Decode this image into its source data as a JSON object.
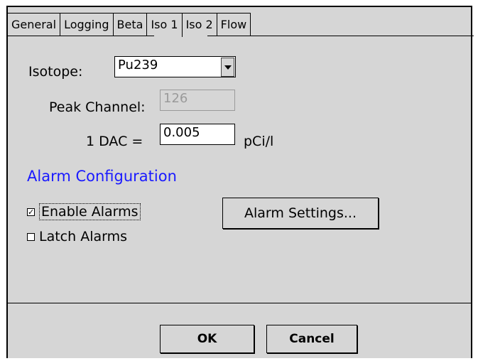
{
  "tabs": [
    "General",
    "Logging",
    "Beta",
    "Iso 1",
    "Iso 2",
    "Flow"
  ],
  "active_tab": "Iso 1",
  "isotope": {
    "label": "Isotope:",
    "value": "Pu239"
  },
  "peak_channel": {
    "label": "Peak Channel:",
    "value": "126"
  },
  "dac": {
    "label": "1 DAC =",
    "value": "0.005",
    "unit": "pCi/l"
  },
  "alarm_section": {
    "title": "Alarm Configuration",
    "enable_label": "Enable Alarms",
    "enable_checked": true,
    "latch_label": "Latch Alarms",
    "latch_checked": false,
    "settings_button": "Alarm Settings..."
  },
  "buttons": {
    "ok": "OK",
    "cancel": "Cancel"
  },
  "colors": {
    "section_title": "#1a1aff",
    "background": "#d6d6d6"
  }
}
